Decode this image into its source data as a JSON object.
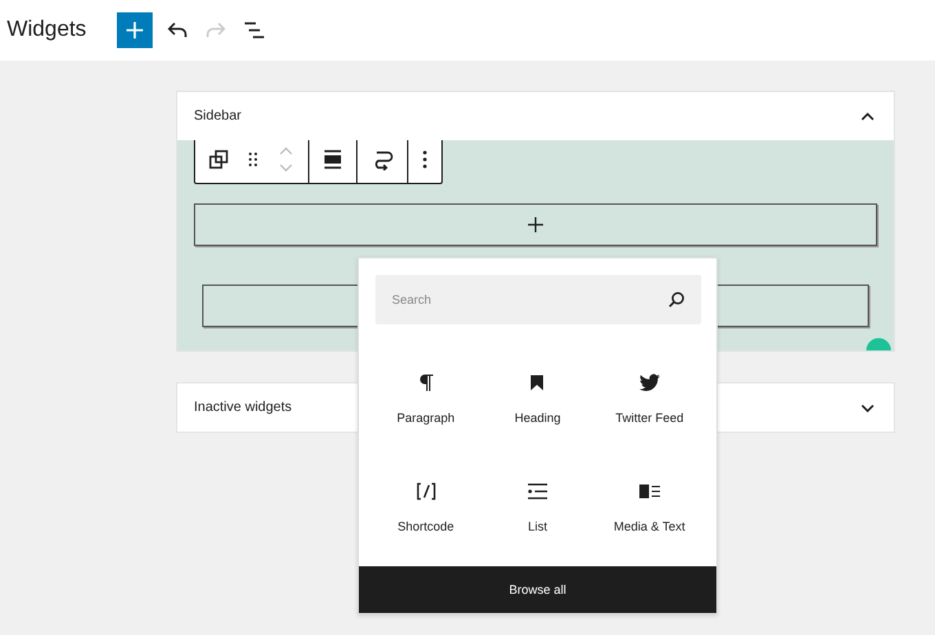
{
  "header": {
    "title": "Widgets",
    "tools": [
      {
        "kind": "add",
        "disabled": false
      },
      {
        "kind": "undo",
        "disabled": false
      },
      {
        "kind": "redo",
        "disabled": true
      },
      {
        "kind": "outline",
        "disabled": false
      }
    ]
  },
  "areas": [
    {
      "title": "Sidebar",
      "expanded": true
    },
    {
      "title": "Inactive widgets",
      "expanded": false
    }
  ],
  "inserter": {
    "search": {
      "placeholder": "Search"
    },
    "blocks": [
      {
        "kind": "paragraph",
        "label": "Paragraph"
      },
      {
        "kind": "heading",
        "label": "Heading"
      },
      {
        "kind": "twitter",
        "label": "Twitter Feed"
      },
      {
        "kind": "shortcode",
        "label": "Shortcode"
      },
      {
        "kind": "list",
        "label": "List"
      },
      {
        "kind": "media",
        "label": "Media & Text"
      }
    ],
    "browse_button": "Browse all"
  }
}
